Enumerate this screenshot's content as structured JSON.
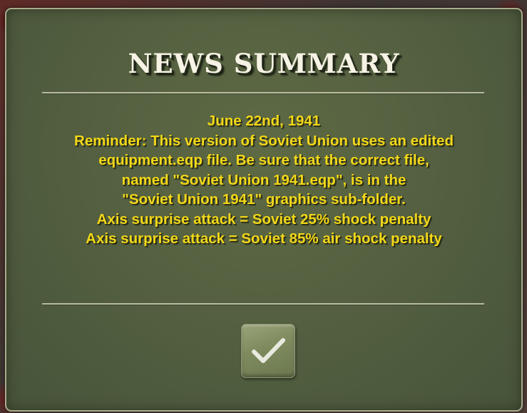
{
  "dialog": {
    "title": "NEWS SUMMARY",
    "message_lines": [
      "June 22nd, 1941",
      "Reminder: This version of Soviet Union uses an edited",
      "equipment.eqp file.  Be sure that the correct file,",
      "named \"Soviet Union 1941.eqp\", is in the",
      "\"Soviet Union 1941\" graphics sub-folder.",
      "Axis surprise attack = Soviet 25% shock penalty",
      "Axis surprise attack = Soviet 85% air shock penalty"
    ],
    "confirm_icon": "checkmark-icon"
  },
  "colors": {
    "panel": "#546040",
    "title_text": "#f6f2e4",
    "message_text": "#f2d81a",
    "divider": "#b9bca1",
    "button": "#7e8a5e"
  }
}
